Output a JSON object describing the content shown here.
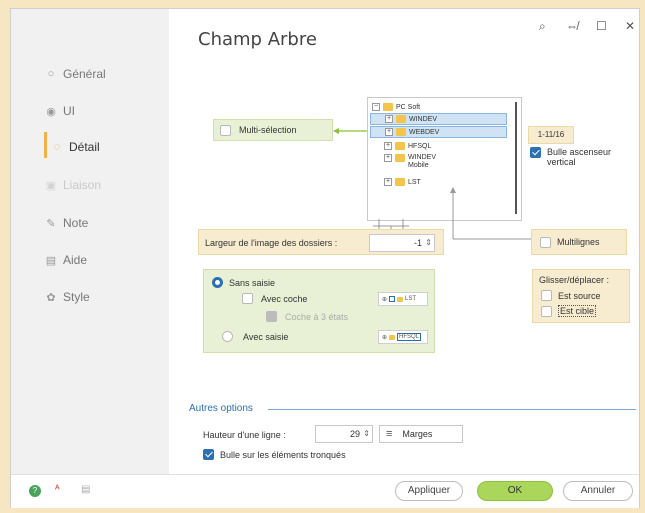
{
  "window": {
    "title": "Champ Arbre",
    "controls": {
      "pin": "⌕",
      "restore": "⇎",
      "maximize": "☐",
      "close": "✕"
    }
  },
  "sidebar": {
    "items": [
      {
        "label": "Général",
        "icon": "radio-icon"
      },
      {
        "label": "UI",
        "icon": "eye-icon"
      },
      {
        "label": "Détail",
        "icon": "detail-icon"
      },
      {
        "label": "Liaison",
        "icon": "link-icon"
      },
      {
        "label": "Note",
        "icon": "pencil-icon"
      },
      {
        "label": "Aide",
        "icon": "help-icon"
      },
      {
        "label": "Style",
        "icon": "palette-icon"
      }
    ]
  },
  "detail": {
    "multiselection_label": "Multi-sélection",
    "tree": {
      "root": "PC Soft",
      "items": [
        "WINDEV",
        "WEBDEV",
        "HFSQL",
        "WINDEV Mobile",
        "LST"
      ]
    },
    "ascenseur_value": "1-11/16",
    "bulle_ascenseur_label": "Bulle ascenseur vertical",
    "largeur_label": "Largeur de l'image des dossiers :",
    "largeur_value": "-1",
    "multilignes_label": "Multilignes",
    "saisie": {
      "sans_saisie": "Sans saisie",
      "avec_coche": "Avec coche",
      "coche_3_etats": "Coche à 3 états",
      "avec_saisie": "Avec saisie",
      "preview1_text": "LST",
      "preview2_text": "HFSQL"
    },
    "glisser": {
      "title": "Glisser/déplacer :",
      "est_source": "Est source",
      "est_cible": "Est cible"
    }
  },
  "autres": {
    "title": "Autres options",
    "hauteur_label": "Hauteur d'une ligne :",
    "hauteur_value": "29",
    "marges_label": "Marges",
    "bulle_tronques": "Bulle sur les éléments tronqués"
  },
  "footer": {
    "appliquer": "Appliquer",
    "ok": "OK",
    "annuler": "Annuler"
  },
  "colors": {
    "accent": "#2d6fb3",
    "ok": "#a9d65b",
    "active_nav": "#f2b24a",
    "background": "#f6e7c2"
  }
}
